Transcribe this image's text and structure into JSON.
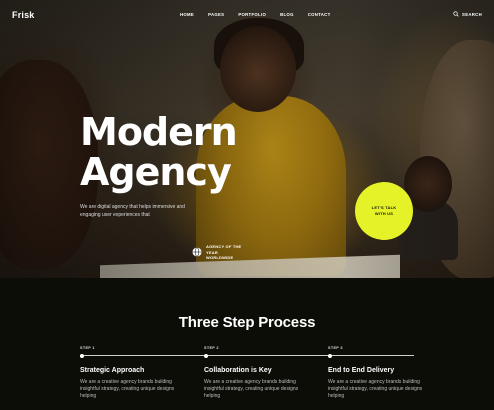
{
  "brand": "Frisk",
  "nav": {
    "items": [
      "HOME",
      "PAGES",
      "PORTFOLIO",
      "BLOG",
      "CONTACT"
    ],
    "search_label": "SEARCH"
  },
  "hero": {
    "title_line1": "Modern",
    "title_line2": "Agency",
    "description": "We are digital agency that helps immersive and engaging user experiences that",
    "award_text": "AGENCY OF THE YEAR WORLDWIDE",
    "cta_label": "LET'S TALK WITH US",
    "cta_color": "#e5f227"
  },
  "process": {
    "title": "Three Step Process",
    "steps": [
      {
        "num": "STEP 1",
        "title": "Strategic Approach",
        "desc": "We are a creative agency brands building insightful strategy, creating unique designs helping"
      },
      {
        "num": "STEP 2",
        "title": "Collaboration is Key",
        "desc": "We are a creative agency brands building insightful strategy, creating unique designs helping"
      },
      {
        "num": "STEP 3",
        "title": "End to End Delivery",
        "desc": "We are a creative agency brands building insightful strategy, creating unique designs helping"
      }
    ]
  },
  "icons": [
    "search-icon",
    "globe-icon"
  ]
}
